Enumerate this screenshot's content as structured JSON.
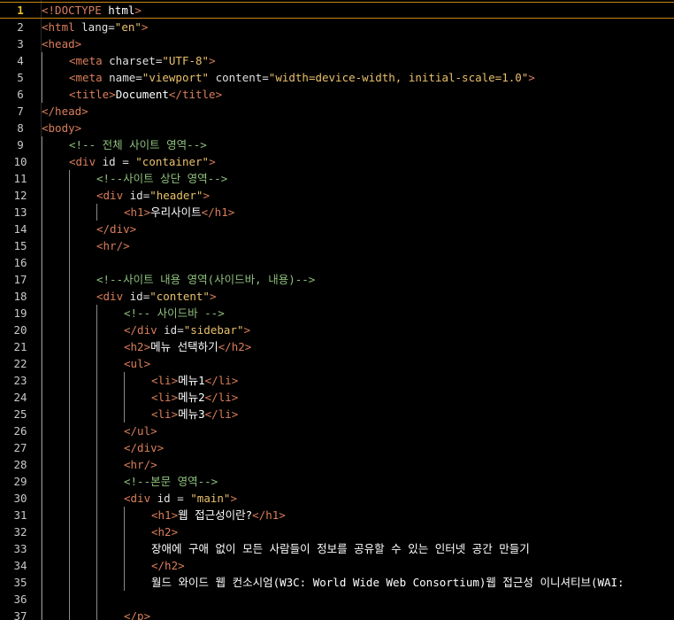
{
  "editor": {
    "colors": {
      "background": "#000000",
      "tag": "#da7e5a",
      "attribute": "#e0e0e0",
      "string": "#e9c06b",
      "comment": "#8ec07c",
      "text": "#ffffff",
      "line_number": "#c9c9c9",
      "current_line_number": "#e8c229",
      "current_line_border": "#c98416"
    },
    "current_line": 1,
    "lines": [
      {
        "num": "1",
        "indent": 0,
        "tokens": [
          {
            "t": "<!DOCTYPE ",
            "c": "tag"
          },
          {
            "t": "html",
            "c": "text"
          },
          {
            "t": ">",
            "c": "tag"
          }
        ]
      },
      {
        "num": "2",
        "indent": 0,
        "tokens": [
          {
            "t": "<html ",
            "c": "tag"
          },
          {
            "t": "lang=",
            "c": "attribute"
          },
          {
            "t": "\"en\"",
            "c": "string"
          },
          {
            "t": ">",
            "c": "tag"
          }
        ]
      },
      {
        "num": "3",
        "indent": 0,
        "tokens": [
          {
            "t": "<head>",
            "c": "tag"
          }
        ]
      },
      {
        "num": "4",
        "indent": 1,
        "tokens": [
          {
            "t": "<meta ",
            "c": "tag"
          },
          {
            "t": "charset=",
            "c": "attribute"
          },
          {
            "t": "\"UTF-8\"",
            "c": "string"
          },
          {
            "t": ">",
            "c": "tag"
          }
        ]
      },
      {
        "num": "5",
        "indent": 1,
        "tokens": [
          {
            "t": "<meta ",
            "c": "tag"
          },
          {
            "t": "name=",
            "c": "attribute"
          },
          {
            "t": "\"viewport\"",
            "c": "string"
          },
          {
            "t": " content=",
            "c": "attribute"
          },
          {
            "t": "\"width=device-width, initial-scale=1.0\"",
            "c": "string"
          },
          {
            "t": ">",
            "c": "tag"
          }
        ]
      },
      {
        "num": "6",
        "indent": 1,
        "tokens": [
          {
            "t": "<title>",
            "c": "tag"
          },
          {
            "t": "Document",
            "c": "text"
          },
          {
            "t": "</title>",
            "c": "tag"
          }
        ]
      },
      {
        "num": "7",
        "indent": 0,
        "tokens": [
          {
            "t": "</head>",
            "c": "tag"
          }
        ]
      },
      {
        "num": "8",
        "indent": 0,
        "tokens": [
          {
            "t": "<body>",
            "c": "tag"
          }
        ]
      },
      {
        "num": "9",
        "indent": 1,
        "tokens": [
          {
            "t": "<!-- 전체 사이트 영역-->",
            "c": "comment"
          }
        ]
      },
      {
        "num": "10",
        "indent": 1,
        "tokens": [
          {
            "t": "<div ",
            "c": "tag"
          },
          {
            "t": "id = ",
            "c": "attribute"
          },
          {
            "t": "\"container\"",
            "c": "string"
          },
          {
            "t": ">",
            "c": "tag"
          }
        ]
      },
      {
        "num": "11",
        "indent": 2,
        "tokens": [
          {
            "t": "<!--사이트 상단 영역-->",
            "c": "comment"
          }
        ]
      },
      {
        "num": "12",
        "indent": 2,
        "tokens": [
          {
            "t": "<div ",
            "c": "tag"
          },
          {
            "t": "id=",
            "c": "attribute"
          },
          {
            "t": "\"header\"",
            "c": "string"
          },
          {
            "t": ">",
            "c": "tag"
          }
        ]
      },
      {
        "num": "13",
        "indent": 3,
        "tokens": [
          {
            "t": "<h1>",
            "c": "tag"
          },
          {
            "t": "우리사이트",
            "c": "text"
          },
          {
            "t": "</h1>",
            "c": "tag"
          }
        ]
      },
      {
        "num": "14",
        "indent": 2,
        "tokens": [
          {
            "t": "</div>",
            "c": "tag"
          }
        ]
      },
      {
        "num": "15",
        "indent": 2,
        "tokens": [
          {
            "t": "<hr/>",
            "c": "tag"
          }
        ]
      },
      {
        "num": "16",
        "indent": 0,
        "tokens": []
      },
      {
        "num": "17",
        "indent": 2,
        "tokens": [
          {
            "t": "<!--사이트 내용 영역(사이드바, 내용)-->",
            "c": "comment"
          }
        ]
      },
      {
        "num": "18",
        "indent": 2,
        "tokens": [
          {
            "t": "<div ",
            "c": "tag"
          },
          {
            "t": "id=",
            "c": "attribute"
          },
          {
            "t": "\"content\"",
            "c": "string"
          },
          {
            "t": ">",
            "c": "tag"
          }
        ]
      },
      {
        "num": "19",
        "indent": 3,
        "tokens": [
          {
            "t": "<!-- 사이드바 -->",
            "c": "comment"
          }
        ]
      },
      {
        "num": "20",
        "indent": 3,
        "tokens": [
          {
            "t": "</div ",
            "c": "tag"
          },
          {
            "t": "id=",
            "c": "attribute"
          },
          {
            "t": "\"sidebar\"",
            "c": "string"
          },
          {
            "t": ">",
            "c": "tag"
          }
        ]
      },
      {
        "num": "21",
        "indent": 3,
        "tokens": [
          {
            "t": "<h2>",
            "c": "tag"
          },
          {
            "t": "메뉴 선택하기",
            "c": "text"
          },
          {
            "t": "</h2>",
            "c": "tag"
          }
        ]
      },
      {
        "num": "22",
        "indent": 3,
        "tokens": [
          {
            "t": "<ul>",
            "c": "tag"
          }
        ]
      },
      {
        "num": "23",
        "indent": 4,
        "tokens": [
          {
            "t": "<li>",
            "c": "tag"
          },
          {
            "t": "메뉴1",
            "c": "text"
          },
          {
            "t": "</li>",
            "c": "tag"
          }
        ]
      },
      {
        "num": "24",
        "indent": 4,
        "tokens": [
          {
            "t": "<li>",
            "c": "tag"
          },
          {
            "t": "메뉴2",
            "c": "text"
          },
          {
            "t": "</li>",
            "c": "tag"
          }
        ]
      },
      {
        "num": "25",
        "indent": 4,
        "tokens": [
          {
            "t": "<li>",
            "c": "tag"
          },
          {
            "t": "메뉴3",
            "c": "text"
          },
          {
            "t": "</li>",
            "c": "tag"
          }
        ]
      },
      {
        "num": "26",
        "indent": 3,
        "tokens": [
          {
            "t": "</ul>",
            "c": "tag"
          }
        ]
      },
      {
        "num": "27",
        "indent": 3,
        "tokens": [
          {
            "t": "</div>",
            "c": "tag"
          }
        ]
      },
      {
        "num": "28",
        "indent": 3,
        "tokens": [
          {
            "t": "<hr/>",
            "c": "tag"
          }
        ]
      },
      {
        "num": "29",
        "indent": 3,
        "tokens": [
          {
            "t": "<!--본문 영역-->",
            "c": "comment"
          }
        ]
      },
      {
        "num": "30",
        "indent": 3,
        "tokens": [
          {
            "t": "<div ",
            "c": "tag"
          },
          {
            "t": "id = ",
            "c": "attribute"
          },
          {
            "t": "\"main\"",
            "c": "string"
          },
          {
            "t": ">",
            "c": "tag"
          }
        ]
      },
      {
        "num": "31",
        "indent": 4,
        "tokens": [
          {
            "t": "<h1>",
            "c": "tag"
          },
          {
            "t": "웹 접근성이란?",
            "c": "text"
          },
          {
            "t": "</h1>",
            "c": "tag"
          }
        ]
      },
      {
        "num": "32",
        "indent": 4,
        "tokens": [
          {
            "t": "<h2>",
            "c": "tag"
          }
        ]
      },
      {
        "num": "33",
        "indent": 4,
        "tokens": [
          {
            "t": "장애에 구애 없이 모든 사람들이 정보를 공유할 수 있는 인터넷 공간 만들기",
            "c": "text"
          }
        ]
      },
      {
        "num": "34",
        "indent": 4,
        "tokens": [
          {
            "t": "</h2>",
            "c": "tag"
          }
        ]
      },
      {
        "num": "35",
        "indent": 4,
        "tokens": [
          {
            "t": "월드 와이드 웹 컨소시엄(W3C: World Wide Web Consortium)웹 접근성 이니셔티브(WAI:",
            "c": "text"
          }
        ]
      },
      {
        "num": "36",
        "indent": 0,
        "tokens": []
      },
      {
        "num": "37",
        "indent": 3,
        "tokens": [
          {
            "t": "</p>",
            "c": "tag"
          }
        ]
      }
    ]
  }
}
